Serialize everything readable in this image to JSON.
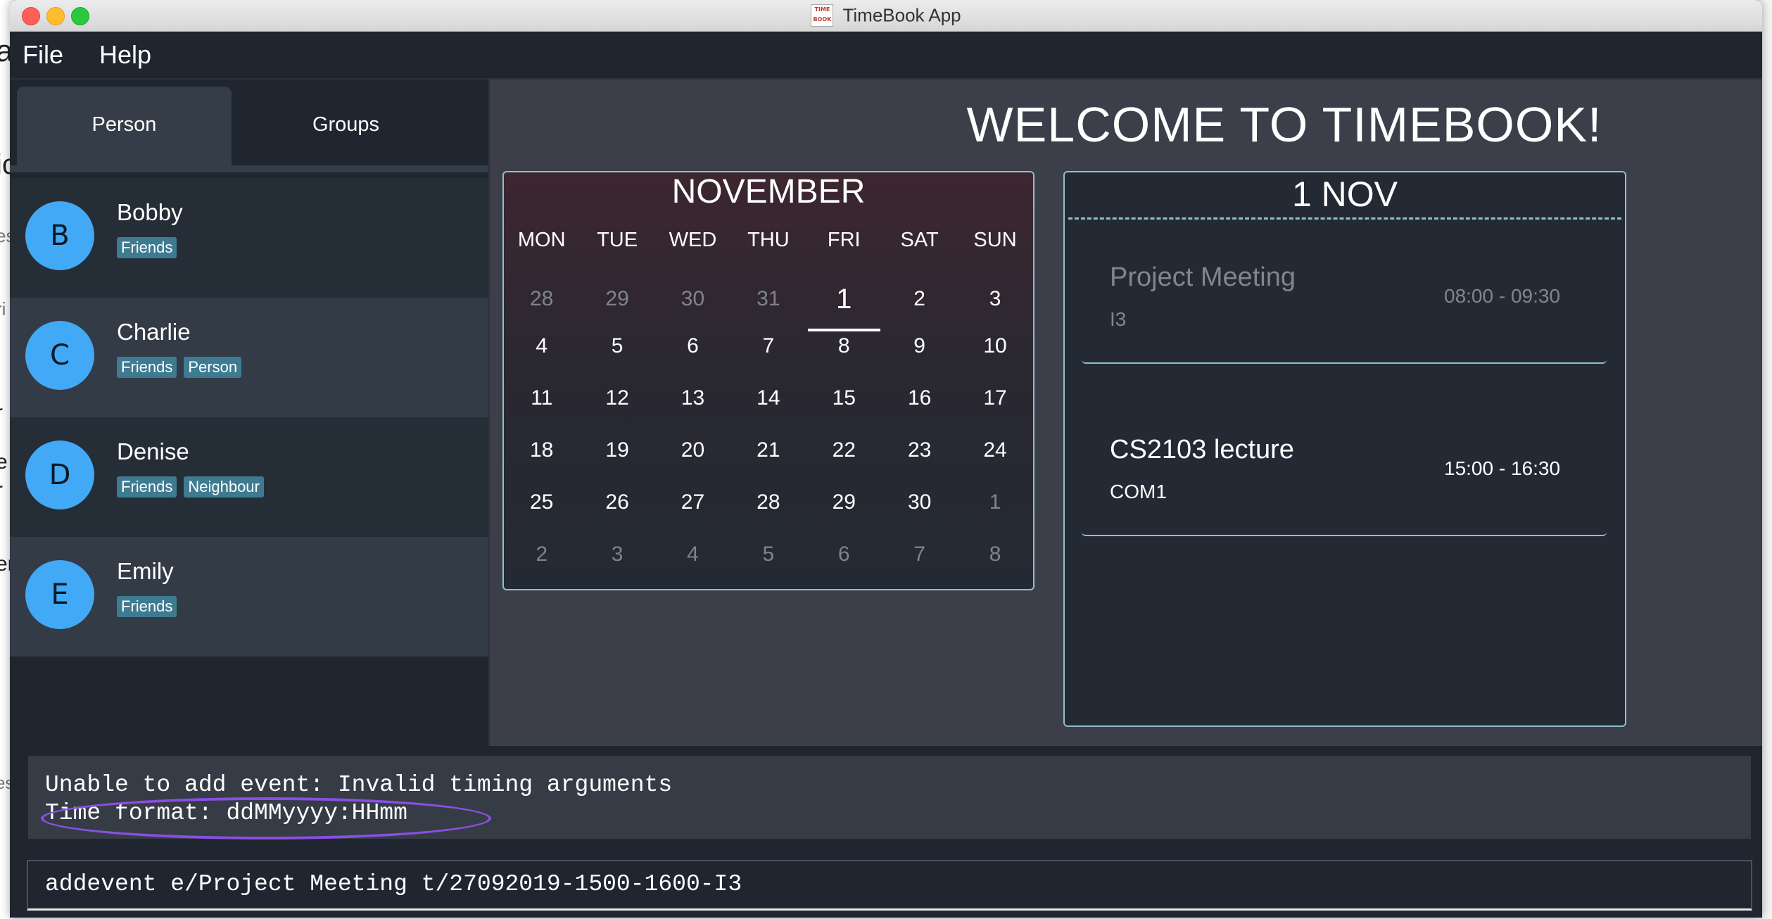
{
  "window": {
    "title": "TimeBook App",
    "icon_label": "TIME BOOK"
  },
  "background_fragments": [
    "a",
    "ic",
    "es",
    "ri",
    "r",
    "e",
    "r",
    "er",
    "es"
  ],
  "menu": {
    "items": [
      "File",
      "Help"
    ]
  },
  "tabs": {
    "person": "Person",
    "groups": "Groups"
  },
  "persons": [
    {
      "initial": "B",
      "name": "Bobby",
      "tags": [
        "Friends"
      ]
    },
    {
      "initial": "C",
      "name": "Charlie",
      "tags": [
        "Friends",
        "Person"
      ]
    },
    {
      "initial": "D",
      "name": "Denise",
      "tags": [
        "Friends",
        "Neighbour"
      ]
    },
    {
      "initial": "E",
      "name": "Emily",
      "tags": [
        "Friends"
      ]
    }
  ],
  "welcome": "WELCOME TO TIMEBOOK!",
  "calendar": {
    "month": "NOVEMBER",
    "weekdays": [
      "MON",
      "TUE",
      "WED",
      "THU",
      "FRI",
      "SAT",
      "SUN"
    ],
    "weeks": [
      [
        {
          "d": "28",
          "dim": true
        },
        {
          "d": "29",
          "dim": true
        },
        {
          "d": "30",
          "dim": true
        },
        {
          "d": "31",
          "dim": true
        },
        {
          "d": "1",
          "today": true
        },
        {
          "d": "2"
        },
        {
          "d": "3"
        }
      ],
      [
        {
          "d": "4"
        },
        {
          "d": "5"
        },
        {
          "d": "6"
        },
        {
          "d": "7"
        },
        {
          "d": "8"
        },
        {
          "d": "9"
        },
        {
          "d": "10"
        }
      ],
      [
        {
          "d": "11"
        },
        {
          "d": "12"
        },
        {
          "d": "13"
        },
        {
          "d": "14"
        },
        {
          "d": "15"
        },
        {
          "d": "16"
        },
        {
          "d": "17"
        }
      ],
      [
        {
          "d": "18"
        },
        {
          "d": "19"
        },
        {
          "d": "20"
        },
        {
          "d": "21"
        },
        {
          "d": "22"
        },
        {
          "d": "23"
        },
        {
          "d": "24"
        }
      ],
      [
        {
          "d": "25"
        },
        {
          "d": "26"
        },
        {
          "d": "27"
        },
        {
          "d": "28"
        },
        {
          "d": "29"
        },
        {
          "d": "30"
        },
        {
          "d": "1",
          "dim": true
        }
      ],
      [
        {
          "d": "2",
          "dim": true
        },
        {
          "d": "3",
          "dim": true
        },
        {
          "d": "4",
          "dim": true
        },
        {
          "d": "5",
          "dim": true
        },
        {
          "d": "6",
          "dim": true
        },
        {
          "d": "7",
          "dim": true
        },
        {
          "d": "8",
          "dim": true
        }
      ]
    ]
  },
  "day_view": {
    "title": "1 NOV",
    "events": [
      {
        "name": "Project Meeting",
        "location": "I3",
        "time": "08:00 - 09:30",
        "past": true
      },
      {
        "name": "CS2103 lecture",
        "location": "COM1",
        "time": "15:00 - 16:30",
        "past": false
      }
    ]
  },
  "result": {
    "line1": "Unable to add event: Invalid timing arguments",
    "line2": "Time format: ddMMyyyy:HHmm",
    "highlight_color": "#8a4fe0"
  },
  "command": {
    "value": "addevent e/Project Meeting t/27092019-1500-1600-I3"
  },
  "colors": {
    "avatar": "#41a9f5",
    "tag": "#3e7b91",
    "accent_border": "#8fc0cc"
  }
}
